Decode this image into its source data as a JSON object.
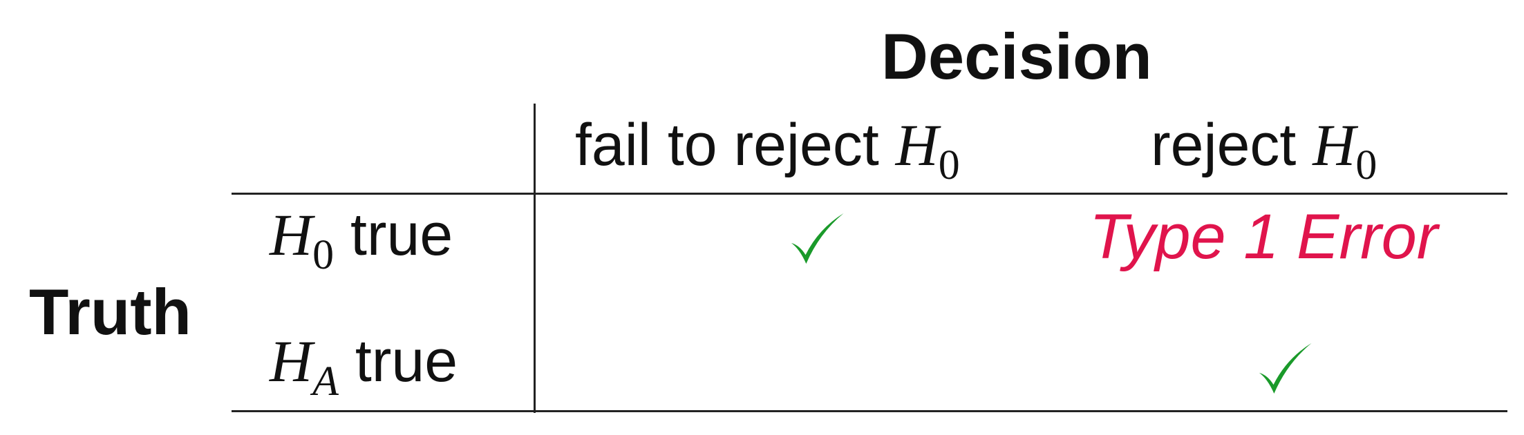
{
  "table": {
    "column_group_header": "Decision",
    "row_group_header": "Truth",
    "columns": [
      {
        "prefix": "fail to reject ",
        "symbol": "H",
        "subscript": "0"
      },
      {
        "prefix": "reject ",
        "symbol": "H",
        "subscript": "0"
      }
    ],
    "rows": [
      {
        "symbol": "H",
        "subscript": "0",
        "suffix": " true"
      },
      {
        "symbol": "H",
        "subscript": "A",
        "suffix": " true"
      }
    ],
    "cells": {
      "h0_true_reject": "Type 1 Error"
    },
    "colors": {
      "check": "#1a9a2a",
      "error": "#e0144c",
      "rules": "#222222"
    }
  }
}
